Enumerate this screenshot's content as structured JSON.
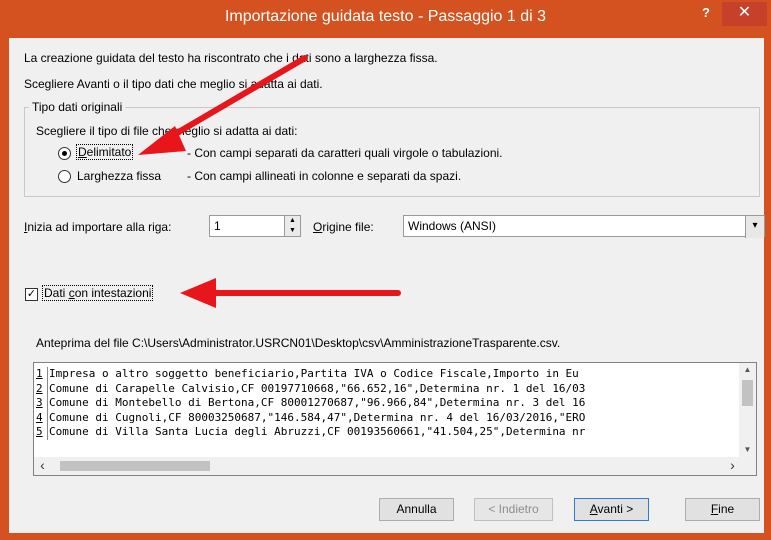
{
  "window": {
    "title": "Importazione guidata testo - Passaggio 1 di 3",
    "help_label": "?",
    "close_label": "✕",
    "accent_color": "#d3521f"
  },
  "intro": {
    "line1": "La creazione guidata del testo ha riscontrato che i dati sono a larghezza fissa.",
    "line2": "Scegliere Avanti o il tipo dati che meglio si adatta ai dati."
  },
  "data_type_group": {
    "title": "Tipo dati originali",
    "prompt": "Scegliere il tipo di file che meglio si adatta ai dati:",
    "options": [
      {
        "label": "Delimitato",
        "access_key": "D",
        "description": "- Con campi separati da caratteri quali virgole o tabulazioni.",
        "selected": true
      },
      {
        "label_pre": "Lar",
        "access_key": "g",
        "label_post": "hezza fissa",
        "description": "- Con campi allineati in colonne e separati da spazi.",
        "selected": false
      }
    ]
  },
  "start_row": {
    "label_access": "I",
    "label_rest": "nizia ad importare alla riga:",
    "value": "1"
  },
  "file_origin": {
    "label_access": "O",
    "label_rest": "rigine file:",
    "value": "Windows (ANSI)"
  },
  "headers_checkbox": {
    "label_pre": "Dati ",
    "label_access": "c",
    "label_post": "on intestazioni",
    "checked": true
  },
  "preview": {
    "label": "Anteprima del file C:\\Users\\Administrator.USRCN01\\Desktop\\csv\\AmministrazioneTrasparente.csv.",
    "rows": [
      {
        "num": "1",
        "text": "Impresa o altro soggetto beneficiario,Partita IVA o Codice Fiscale,Importo in Eu"
      },
      {
        "num": "2",
        "text": "Comune di Carapelle Calvisio,CF 00197710668,\"66.652,16\",Determina nr. 1 del 16/03"
      },
      {
        "num": "3",
        "text": "Comune di Montebello di Bertona,CF 80001270687,\"96.966,84\",Determina nr. 3 del 16"
      },
      {
        "num": "4",
        "text": "Comune di Cugnoli,CF 80003250687,\"146.584,47\",Determina nr. 4 del 16/03/2016,\"ERO"
      },
      {
        "num": "5",
        "text": "Comune di Villa Santa Lucia degli Abruzzi,CF 00193560661,\"41.504,25\",Determina nr"
      }
    ]
  },
  "buttons": {
    "cancel": "Annulla",
    "back": "< Indietro",
    "next_access": "A",
    "next_rest": "vanti >",
    "finish_access": "F",
    "finish_rest": "ine"
  },
  "annotations": {
    "arrow_color": "#e8151b"
  }
}
